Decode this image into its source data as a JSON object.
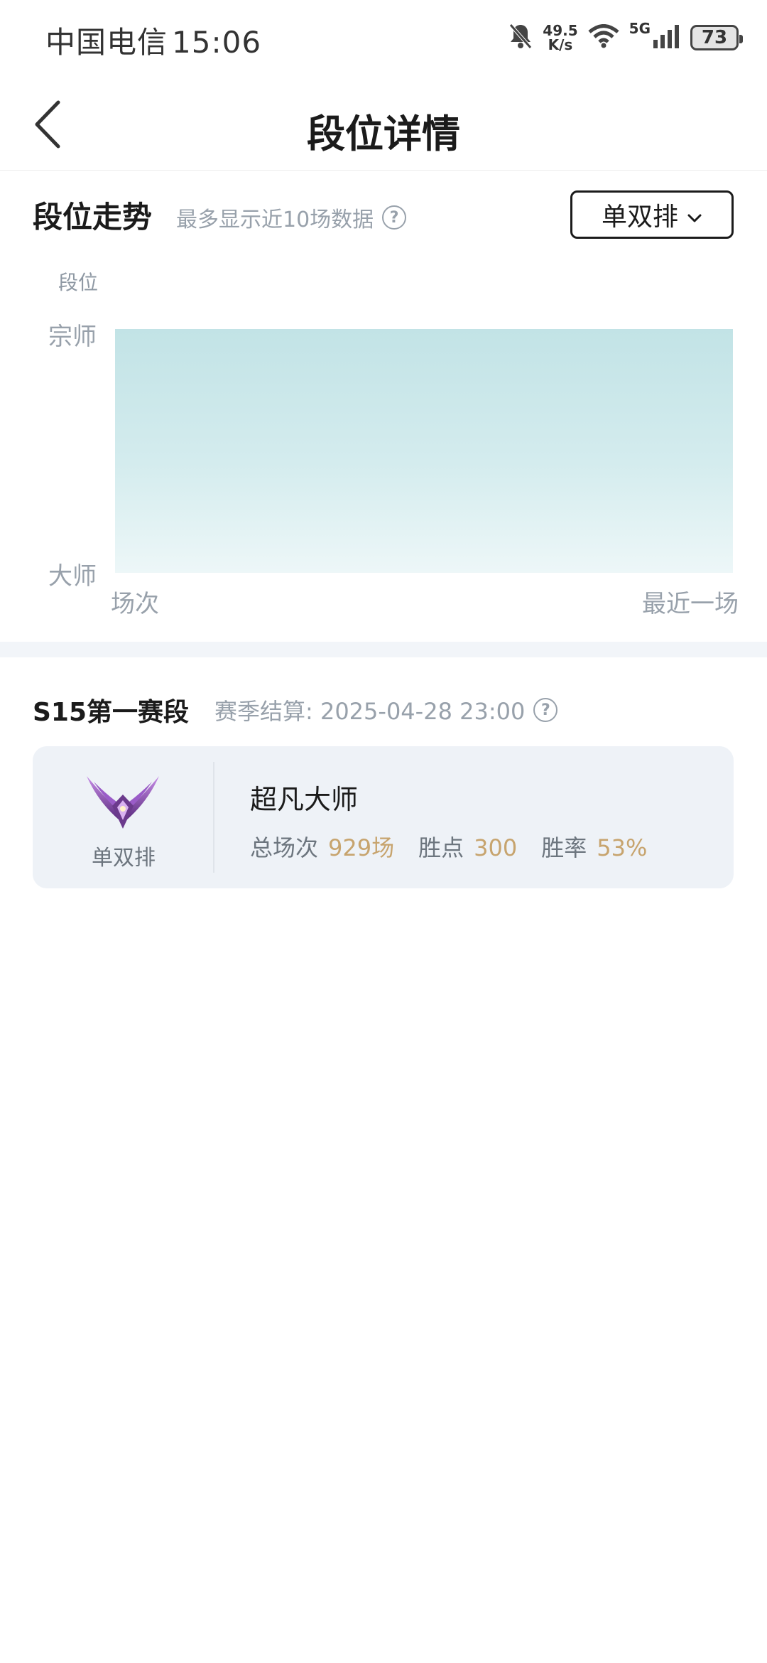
{
  "status_bar": {
    "carrier": "中国电信",
    "time": "15:06",
    "net_speed_value": "49.5",
    "net_speed_unit": "K/s",
    "network_type": "5G",
    "battery": "73",
    "icons": [
      "bell-muted-icon",
      "wifi-icon",
      "signal-icon",
      "battery-icon"
    ]
  },
  "header": {
    "title": "段位详情",
    "back_icon": "chevron-left-icon"
  },
  "trend": {
    "title": "段位走势",
    "subtitle": "最多显示近10场数据",
    "help": "?",
    "queue_select": "单双排",
    "chevron_icon": "chevron-down-icon",
    "y_axis_title": "段位",
    "y_top": "宗师",
    "y_bottom": "大师",
    "x_left": "场次",
    "x_right": "最近一场",
    "area_color": "#c2e3e6"
  },
  "season": {
    "title": "S15第一赛段",
    "settle_text": "赛季结算: 2025-04-28 23:00",
    "help": "?",
    "card": {
      "emblem_icon": "master-tier-emblem-icon",
      "queue": "单双排",
      "rank_name": "超凡大师",
      "total_label": "总场次",
      "total_value": "929场",
      "lp_label": "胜点",
      "lp_value": "300",
      "winrate_label": "胜率",
      "winrate_value": "53%"
    }
  },
  "colors": {
    "accent_gold": "#c7a46e",
    "muted_text": "#98a1ab",
    "card_bg": "#eef2f7"
  }
}
